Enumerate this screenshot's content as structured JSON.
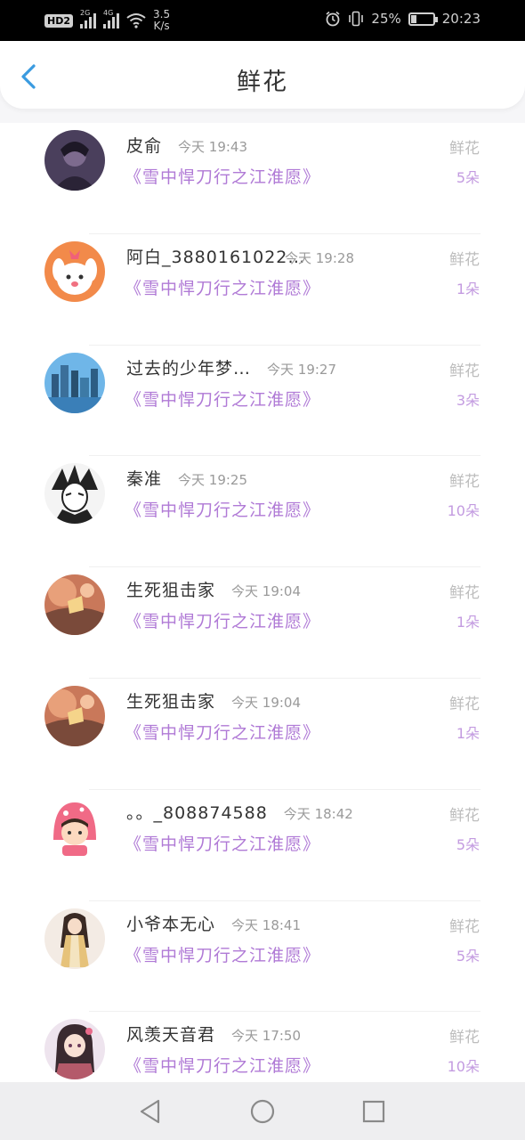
{
  "status_bar": {
    "hd": "HD",
    "hd_sub": "2",
    "sig1_label": "2G",
    "sig2_label": "4G",
    "net_speed": "3.5",
    "net_unit": "K/s",
    "battery_percent": "25%",
    "battery_level": 0.25,
    "time": "20:23"
  },
  "header": {
    "title": "鲜花"
  },
  "items": [
    {
      "name": "皮俞",
      "time": "今天 19:43",
      "title": "《雪中悍刀行之江淮愿》",
      "label": "鲜花",
      "count": "5朵"
    },
    {
      "name": "阿白_3880161022…",
      "time": "今天 19:28",
      "title": "《雪中悍刀行之江淮愿》",
      "label": "鲜花",
      "count": "1朵"
    },
    {
      "name": "过去的少年梦…",
      "time": "今天 19:27",
      "title": "《雪中悍刀行之江淮愿》",
      "label": "鲜花",
      "count": "3朵"
    },
    {
      "name": "秦准",
      "time": "今天 19:25",
      "title": "《雪中悍刀行之江淮愿》",
      "label": "鲜花",
      "count": "10朵"
    },
    {
      "name": "生死狙击家",
      "time": "今天 19:04",
      "title": "《雪中悍刀行之江淮愿》",
      "label": "鲜花",
      "count": "1朵"
    },
    {
      "name": "生死狙击家",
      "time": "今天 19:04",
      "title": "《雪中悍刀行之江淮愿》",
      "label": "鲜花",
      "count": "1朵"
    },
    {
      "name": "。。_808874588",
      "time": "今天 18:42",
      "title": "《雪中悍刀行之江淮愿》",
      "label": "鲜花",
      "count": "5朵"
    },
    {
      "name": "小爷本无心",
      "time": "今天 18:41",
      "title": "《雪中悍刀行之江淮愿》",
      "label": "鲜花",
      "count": "5朵"
    },
    {
      "name": "风羡天音君",
      "time": "今天 17:50",
      "title": "《雪中悍刀行之江淮愿》",
      "label": "鲜花",
      "count": "10朵"
    }
  ],
  "colors": {
    "accent_purple": "#b07ad6",
    "back_blue": "#3a9be0"
  }
}
